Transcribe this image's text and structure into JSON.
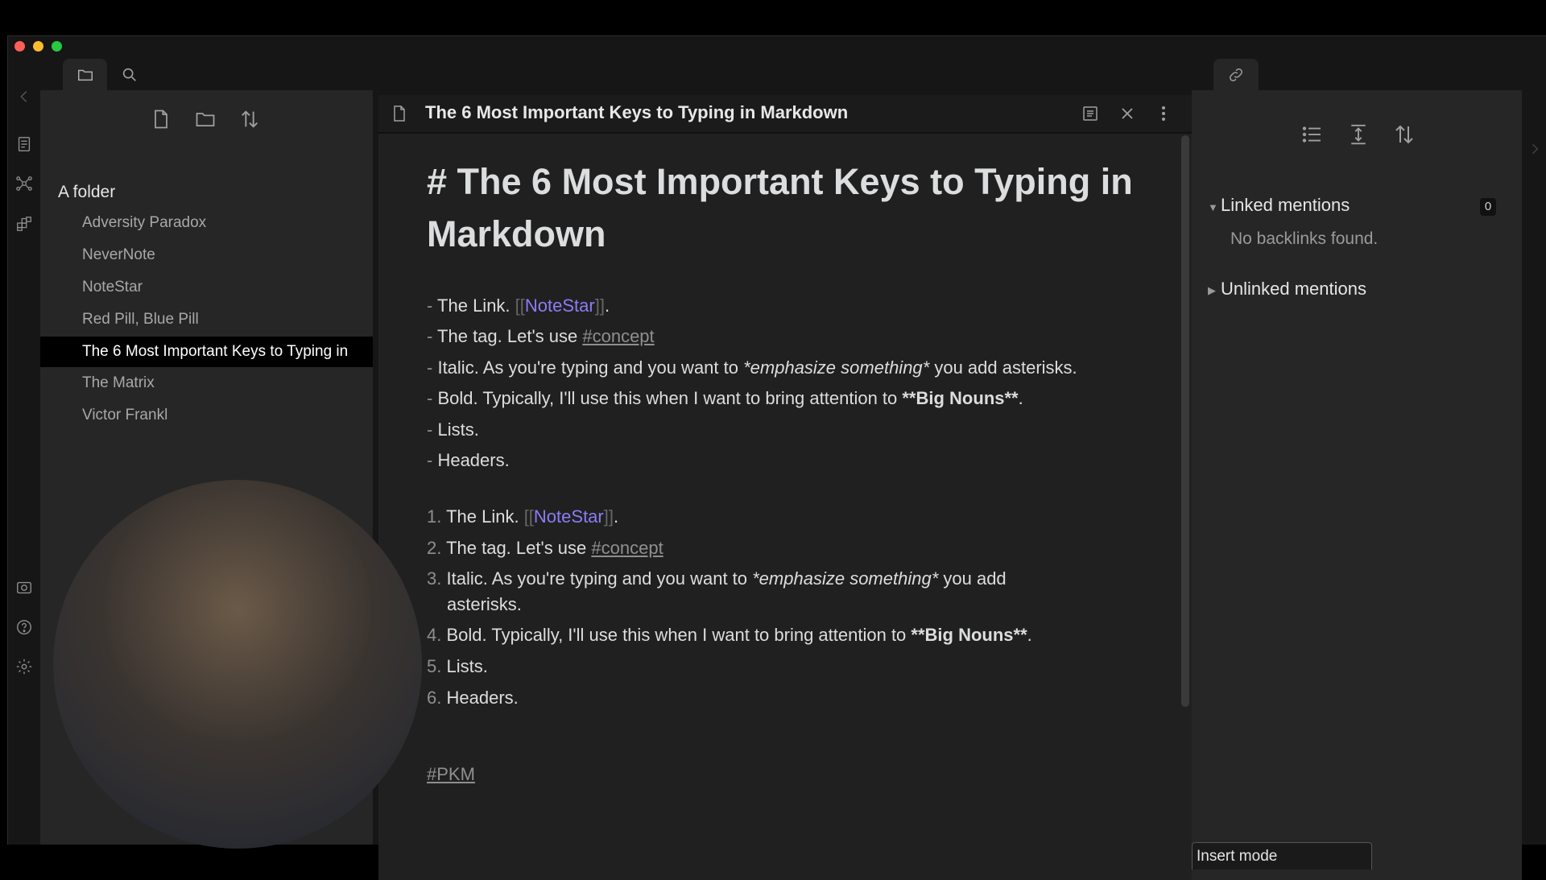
{
  "window": {
    "traffic_lights": {
      "close": "#ff5f57",
      "minimize": "#febc2e",
      "zoom": "#28c840"
    }
  },
  "ribbon": {
    "icons": [
      "file-explorer-icon",
      "graph-icon",
      "plugins-icon",
      "vault-icon",
      "help-icon",
      "settings-icon"
    ]
  },
  "file_explorer": {
    "folder_title": "A folder",
    "files": [
      {
        "label": "Adversity Paradox",
        "active": false
      },
      {
        "label": "NeverNote",
        "active": false
      },
      {
        "label": "NoteStar",
        "active": false
      },
      {
        "label": "Red Pill, Blue Pill",
        "active": false
      },
      {
        "label": "The 6 Most Important Keys to Typing in",
        "active": true
      },
      {
        "label": "The Matrix",
        "active": false
      },
      {
        "label": "Victor Frankl",
        "active": false
      }
    ]
  },
  "editor": {
    "tab_title": "The 6 Most Important Keys to Typing in Markdown",
    "heading": "# The 6 Most Important Keys to Typing in Markdown",
    "bullets": {
      "dash": "-",
      "b1": {
        "pre": "The Link. ",
        "open": "[[",
        "link": "NoteStar",
        "close": "]]",
        "post": "."
      },
      "b2": {
        "pre": "The tag. Let's use ",
        "tag": "#concept"
      },
      "b3": {
        "pre": "Italic. As you're typing and you want to ",
        "em": "*emphasize something*",
        "post": " you add asterisks."
      },
      "b4": {
        "pre": "Bold. Typically, I'll use this when I want to bring attention to ",
        "strong": "**Big Nouns**",
        "post": "."
      },
      "b5": "Lists.",
      "b6": "Headers."
    },
    "numbered": {
      "n1": {
        "num": "1.",
        "pre": "The Link. ",
        "open": "[[",
        "link": "NoteStar",
        "close": "]]",
        "post": "."
      },
      "n2": {
        "num": "2.",
        "pre": "The tag. Let's use ",
        "tag": "#concept"
      },
      "n3": {
        "num": "3.",
        "pre": "Italic. As you're typing and you want to ",
        "em": "*emphasize something*",
        "post": " you add",
        "cont": "asterisks."
      },
      "n4": {
        "num": "4.",
        "pre": "Bold. Typically, I'll use this when I want to bring attention to ",
        "strong": "**Big Nouns**",
        "post": "."
      },
      "n5": {
        "num": "5.",
        "text": "Lists."
      },
      "n6": {
        "num": "6.",
        "text": "Headers."
      }
    },
    "footer_tag": "#PKM"
  },
  "backlinks": {
    "linked_label": "Linked mentions",
    "linked_count": "0",
    "no_backlinks": "No backlinks found.",
    "unlinked_label": "Unlinked mentions",
    "expanded_caret": "▼",
    "collapsed_caret": "▶"
  },
  "status_bar": {
    "mode": "Insert mode"
  }
}
